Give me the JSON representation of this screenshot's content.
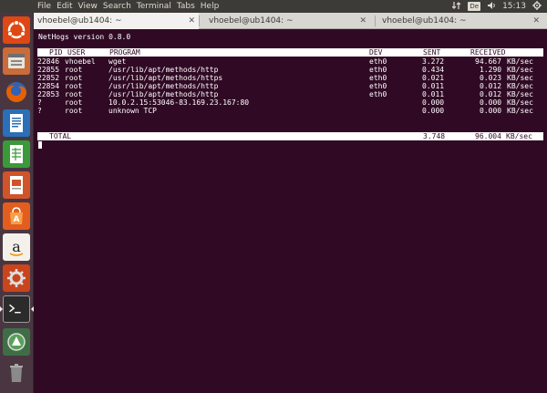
{
  "menubar": {
    "items": [
      "File",
      "Edit",
      "View",
      "Search",
      "Terminal",
      "Tabs",
      "Help"
    ],
    "keyboard_layout": "De",
    "clock": "15:13"
  },
  "launcher": {
    "icons": [
      "dash-icon",
      "files-icon",
      "firefox-icon",
      "writer-icon",
      "calc-icon",
      "impress-icon",
      "software-center-icon",
      "amazon-icon",
      "settings-icon",
      "terminal-icon",
      "update-icon",
      "trash-icon"
    ]
  },
  "tabs": [
    {
      "title": "vhoebel@ub1404: ~",
      "active": true
    },
    {
      "title": "vhoebel@ub1404: ~",
      "active": false
    },
    {
      "title": "vhoebel@ub1404: ~",
      "active": false
    }
  ],
  "terminal": {
    "header": "NetHogs version 0.8.0",
    "columns": {
      "pid": "PID",
      "user": "USER",
      "program": "PROGRAM",
      "dev": "DEV",
      "sent": "SENT",
      "received": "RECEIVED"
    },
    "rows": [
      {
        "pid": "22846",
        "user": "vhoebel",
        "program": "wget",
        "dev": "eth0",
        "sent": "3.272",
        "received": "94.667",
        "unit": "KB/sec"
      },
      {
        "pid": "22855",
        "user": "root",
        "program": "/usr/lib/apt/methods/http",
        "dev": "eth0",
        "sent": "0.434",
        "received": "1.290",
        "unit": "KB/sec"
      },
      {
        "pid": "22852",
        "user": "root",
        "program": "/usr/lib/apt/methods/https",
        "dev": "eth0",
        "sent": "0.021",
        "received": "0.023",
        "unit": "KB/sec"
      },
      {
        "pid": "22854",
        "user": "root",
        "program": "/usr/lib/apt/methods/http",
        "dev": "eth0",
        "sent": "0.011",
        "received": "0.012",
        "unit": "KB/sec"
      },
      {
        "pid": "22853",
        "user": "root",
        "program": "/usr/lib/apt/methods/http",
        "dev": "eth0",
        "sent": "0.011",
        "received": "0.012",
        "unit": "KB/sec"
      },
      {
        "pid": "?",
        "user": "root",
        "program": "10.0.2.15:53046-83.169.23.167:80",
        "dev": "",
        "sent": "0.000",
        "received": "0.000",
        "unit": "KB/sec"
      },
      {
        "pid": "?",
        "user": "root",
        "program": "unknown TCP",
        "dev": "",
        "sent": "0.000",
        "received": "0.000",
        "unit": "KB/sec"
      }
    ],
    "total": {
      "label": "TOTAL",
      "sent": "3.748",
      "received": "96.004",
      "unit": "KB/sec"
    }
  },
  "colors": {
    "terminal_bg": "#300a24",
    "launcher_bg": "#4a3640",
    "panel_bg": "#3c3b37",
    "ubuntu_orange": "#dd4814"
  }
}
